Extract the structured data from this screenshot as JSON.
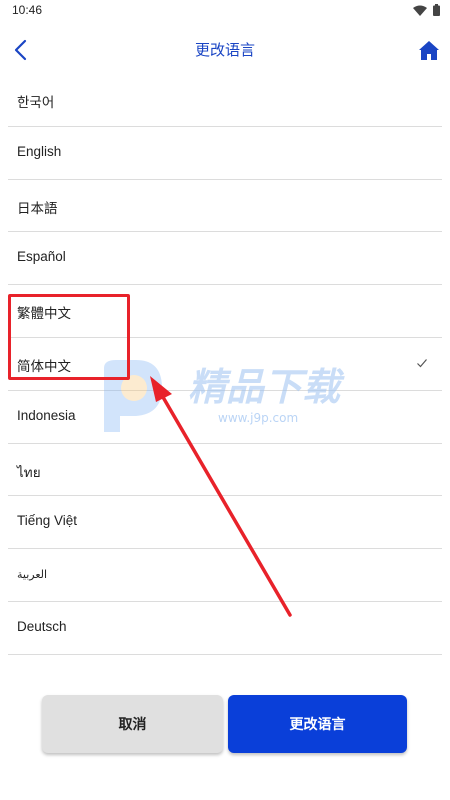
{
  "status_bar": {
    "time": "10:46",
    "icons": [
      "wifi-icon",
      "battery-icon"
    ]
  },
  "header": {
    "title": "更改语言",
    "back_icon": "chevron-left-icon",
    "home_icon": "home-icon"
  },
  "languages": [
    {
      "label": "한국어",
      "selected": false
    },
    {
      "label": "English",
      "selected": false
    },
    {
      "label": "日本語",
      "selected": false
    },
    {
      "label": "Español",
      "selected": false
    },
    {
      "label": "繁體中文",
      "selected": false
    },
    {
      "label": "简体中文",
      "selected": true
    },
    {
      "label": "Indonesia",
      "selected": false
    },
    {
      "label": "ไทย",
      "selected": false
    },
    {
      "label": "Tiếng Việt",
      "selected": false
    },
    {
      "label": "العربية",
      "selected": false
    },
    {
      "label": "Deutsch",
      "selected": false
    }
  ],
  "footer": {
    "cancel_label": "取消",
    "confirm_label": "更改语言"
  },
  "watermark": {
    "title": "精品下载",
    "url": "www.j9p.com"
  },
  "colors": {
    "accent": "#0a3fd9",
    "title": "#1a45c4",
    "annotation": "#e8222a",
    "divider": "#dcdcdc"
  }
}
